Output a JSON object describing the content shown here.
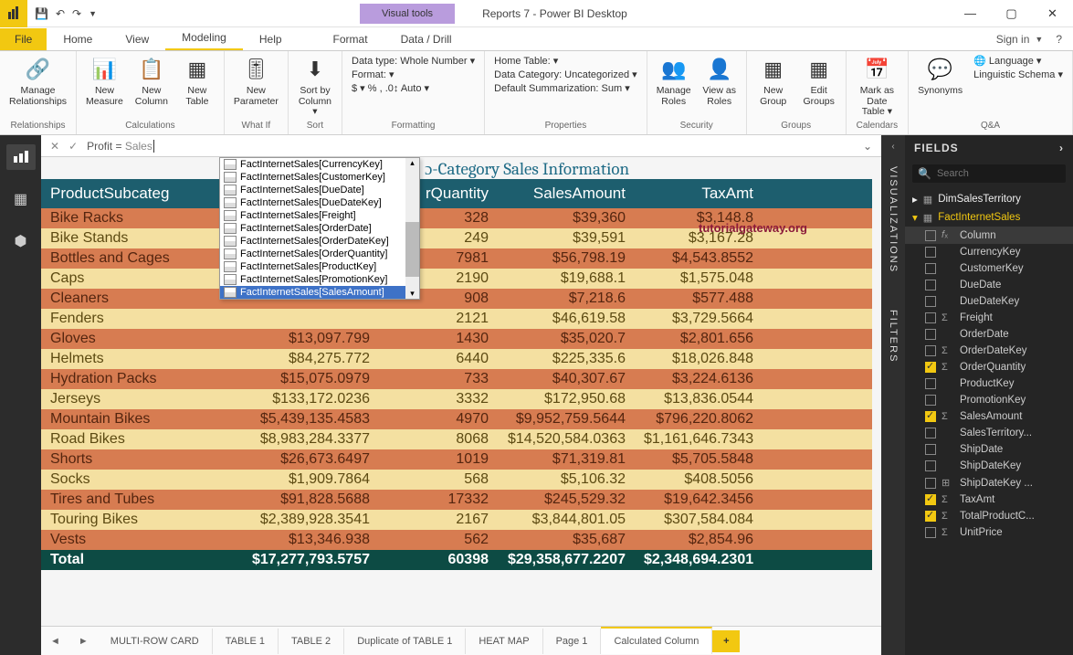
{
  "window": {
    "title": "Reports 7 - Power BI Desktop",
    "visual_tools": "Visual tools",
    "min": "—",
    "max": "▢",
    "close": "✕",
    "signin": "Sign in"
  },
  "menu": {
    "file": "File",
    "tabs": [
      "Home",
      "View",
      "Modeling",
      "Help",
      "Format",
      "Data / Drill"
    ]
  },
  "ribbon": {
    "manage_rel": "Manage\nRelationships",
    "relationships": "Relationships",
    "new_measure": "New\nMeasure",
    "new_column": "New\nColumn",
    "new_table": "New\nTable",
    "calculations": "Calculations",
    "new_param": "New\nParameter",
    "whatif": "What If",
    "sort_by": "Sort by\nColumn ▾",
    "sort": "Sort",
    "datatype": "Data type: Whole Number ▾",
    "format_lbl": "Format: ▾",
    "currency_row": "$ ▾  %  ,  .0↕  Auto ▾",
    "formatting": "Formatting",
    "home_table": "Home Table: ▾",
    "data_cat": "Data Category: Uncategorized ▾",
    "def_sum": "Default Summarization: Sum ▾",
    "properties": "Properties",
    "manage_roles": "Manage\nRoles",
    "view_roles": "View as\nRoles",
    "security": "Security",
    "new_group": "New\nGroup",
    "edit_groups": "Edit\nGroups",
    "groups": "Groups",
    "mark_date": "Mark as\nDate Table ▾",
    "calendars": "Calendars",
    "synonyms": "Synonyms",
    "language": "🌐 Language ▾",
    "ling": "Linguistic Schema ▾",
    "qa": "Q&A"
  },
  "formula": {
    "text": "Profit = ",
    "typed": "Sales"
  },
  "intellisense": [
    "FactInternetSales[CurrencyKey]",
    "FactInternetSales[CustomerKey]",
    "FactInternetSales[DueDate]",
    "FactInternetSales[DueDateKey]",
    "FactInternetSales[Freight]",
    "FactInternetSales[OrderDate]",
    "FactInternetSales[OrderDateKey]",
    "FactInternetSales[OrderQuantity]",
    "FactInternetSales[ProductKey]",
    "FactInternetSales[PromotionKey]",
    "FactInternetSales[SalesAmount]"
  ],
  "intellisense_selected": 10,
  "report_title_partial": "ɔ-Category Sales Information",
  "watermark": "tutorialgateway.org",
  "table": {
    "headers": [
      "ProductSubcateg",
      "",
      "rQuantity",
      "SalesAmount",
      "TaxAmt"
    ],
    "rows": [
      [
        "Bike Racks",
        "",
        "328",
        "$39,360",
        "$3,148.8"
      ],
      [
        "Bike Stands",
        "",
        "249",
        "$39,591",
        "$3,167.28"
      ],
      [
        "Bottles and Cages",
        "",
        "7981",
        "$56,798.19",
        "$4,543.8552"
      ],
      [
        "Caps",
        "",
        "2190",
        "$19,688.1",
        "$1,575.048"
      ],
      [
        "Cleaners",
        "",
        "908",
        "$7,218.6",
        "$577.488"
      ],
      [
        "Fenders",
        "",
        "2121",
        "$46,619.58",
        "$3,729.5664"
      ],
      [
        "Gloves",
        "$13,097.799",
        "1430",
        "$35,020.7",
        "$2,801.656"
      ],
      [
        "Helmets",
        "$84,275.772",
        "6440",
        "$225,335.6",
        "$18,026.848"
      ],
      [
        "Hydration Packs",
        "$15,075.0979",
        "733",
        "$40,307.67",
        "$3,224.6136"
      ],
      [
        "Jerseys",
        "$133,172.0236",
        "3332",
        "$172,950.68",
        "$13,836.0544"
      ],
      [
        "Mountain Bikes",
        "$5,439,135.4583",
        "4970",
        "$9,952,759.5644",
        "$796,220.8062"
      ],
      [
        "Road Bikes",
        "$8,983,284.3377",
        "8068",
        "$14,520,584.0363",
        "$1,161,646.7343"
      ],
      [
        "Shorts",
        "$26,673.6497",
        "1019",
        "$71,319.81",
        "$5,705.5848"
      ],
      [
        "Socks",
        "$1,909.7864",
        "568",
        "$5,106.32",
        "$408.5056"
      ],
      [
        "Tires and Tubes",
        "$91,828.5688",
        "17332",
        "$245,529.32",
        "$19,642.3456"
      ],
      [
        "Touring Bikes",
        "$2,389,928.3541",
        "2167",
        "$3,844,801.05",
        "$307,584.084"
      ],
      [
        "Vests",
        "$13,346.938",
        "562",
        "$35,687",
        "$2,854.96"
      ]
    ],
    "total": [
      "Total",
      "$17,277,793.5757",
      "60398",
      "$29,358,677.2207",
      "$2,348,694.2301"
    ]
  },
  "page_tabs": [
    "MULTI-ROW CARD",
    "TABLE 1",
    "TABLE 2",
    "Duplicate of TABLE 1",
    "HEAT MAP",
    "Page 1",
    "Calculated Column"
  ],
  "page_tabs_active": 6,
  "side_labels": {
    "viz": "VISUALIZATIONS",
    "filters": "FILTERS"
  },
  "fields_panel": {
    "title": "FIELDS",
    "search_ph": "Search",
    "tables": [
      {
        "name": "DimSalesTerritory",
        "expanded": false
      },
      {
        "name": "FactInternetSales",
        "expanded": true,
        "cols": [
          {
            "n": "Column",
            "on": false,
            "sel": true,
            "icon": "f"
          },
          {
            "n": "CurrencyKey",
            "on": false
          },
          {
            "n": "CustomerKey",
            "on": false
          },
          {
            "n": "DueDate",
            "on": false
          },
          {
            "n": "DueDateKey",
            "on": false
          },
          {
            "n": "Freight",
            "on": false,
            "sigma": true
          },
          {
            "n": "OrderDate",
            "on": false
          },
          {
            "n": "OrderDateKey",
            "on": false,
            "sigma": true
          },
          {
            "n": "OrderQuantity",
            "on": true,
            "sigma": true
          },
          {
            "n": "ProductKey",
            "on": false
          },
          {
            "n": "PromotionKey",
            "on": false
          },
          {
            "n": "SalesAmount",
            "on": true,
            "sigma": true
          },
          {
            "n": "SalesTerritory...",
            "on": false
          },
          {
            "n": "ShipDate",
            "on": false
          },
          {
            "n": "ShipDateKey",
            "on": false
          },
          {
            "n": "ShipDateKey ...",
            "on": false,
            "hier": true
          },
          {
            "n": "TaxAmt",
            "on": true,
            "sigma": true
          },
          {
            "n": "TotalProductC...",
            "on": true,
            "sigma": true
          },
          {
            "n": "UnitPrice",
            "on": false,
            "sigma": true
          }
        ]
      }
    ]
  }
}
